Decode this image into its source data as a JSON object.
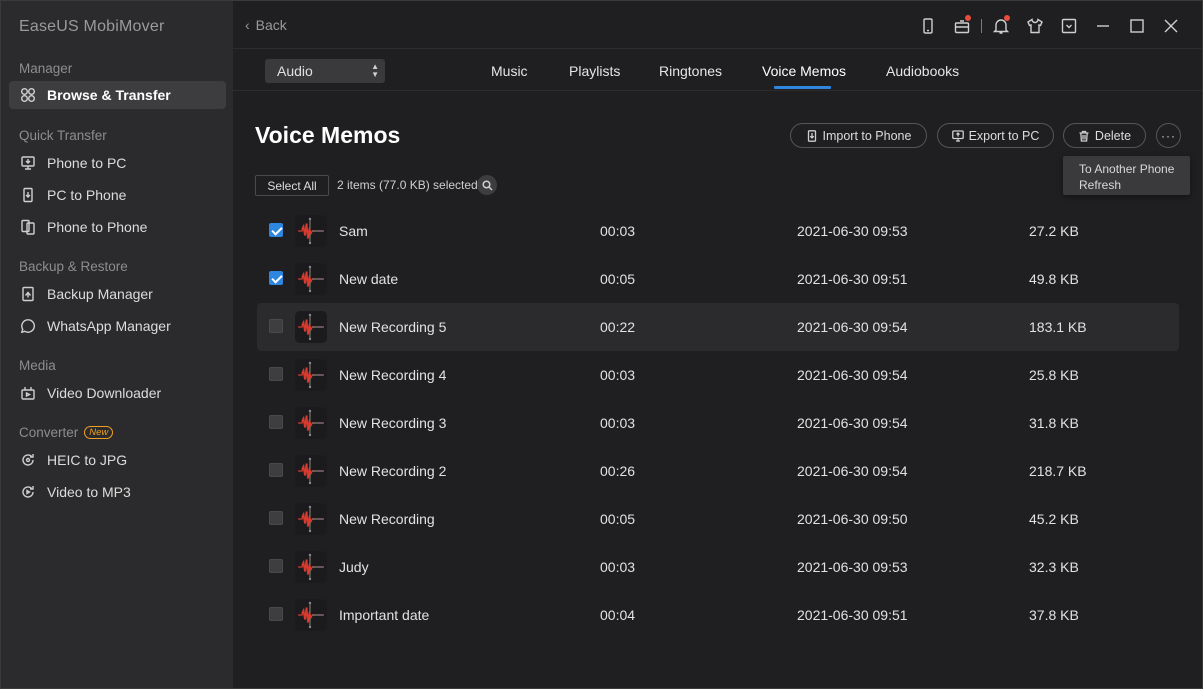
{
  "app": {
    "title": "EaseUS MobiMover"
  },
  "sidebar": {
    "sections": [
      {
        "heading": "Manager",
        "items": [
          {
            "label": "Browse & Transfer",
            "icon": "grid-icon"
          }
        ]
      },
      {
        "heading": "Quick Transfer",
        "items": [
          {
            "label": "Phone to PC",
            "icon": "phone-to-pc-icon"
          },
          {
            "label": "PC to Phone",
            "icon": "pc-to-phone-icon"
          },
          {
            "label": "Phone to Phone",
            "icon": "phone-to-phone-icon"
          }
        ]
      },
      {
        "heading": "Backup & Restore",
        "items": [
          {
            "label": "Backup Manager",
            "icon": "backup-icon"
          },
          {
            "label": "WhatsApp Manager",
            "icon": "whatsapp-icon"
          }
        ]
      },
      {
        "heading": "Media",
        "items": [
          {
            "label": "Video Downloader",
            "icon": "video-download-icon"
          }
        ]
      },
      {
        "heading": "Converter",
        "badge": "New",
        "items": [
          {
            "label": "HEIC to JPG",
            "icon": "convert-icon"
          },
          {
            "label": "Video to MP3",
            "icon": "convert-icon"
          }
        ]
      }
    ]
  },
  "topbar": {
    "back_label": "Back",
    "icons": [
      "device-icon",
      "gift-icon",
      "bell-icon",
      "shirt-icon",
      "dropdown-menu-icon",
      "minimize-icon",
      "maximize-icon",
      "close-icon"
    ]
  },
  "tabbar": {
    "category": "Audio",
    "tabs": [
      "Music",
      "Playlists",
      "Ringtones",
      "Voice Memos",
      "Audiobooks"
    ],
    "active_tab": "Voice Memos"
  },
  "main": {
    "title": "Voice Memos",
    "actions": {
      "import": "Import to Phone",
      "export": "Export to PC",
      "delete": "Delete",
      "more": "···"
    },
    "more_menu": [
      "To Another Phone",
      "Refresh"
    ],
    "select_all": "Select All",
    "selection_info": "2 items (77.0 KB) selected"
  },
  "colors": {
    "accent": "#2e86de",
    "memo_icon": "#d63a2f"
  },
  "memos": [
    {
      "name": "Sam",
      "duration": "00:03",
      "date": "2021-06-30 09:53",
      "size": "27.2 KB",
      "checked": true
    },
    {
      "name": "New date",
      "duration": "00:05",
      "date": "2021-06-30 09:51",
      "size": "49.8 KB",
      "checked": true
    },
    {
      "name": "New Recording 5",
      "duration": "00:22",
      "date": "2021-06-30 09:54",
      "size": "183.1 KB",
      "checked": false
    },
    {
      "name": "New Recording 4",
      "duration": "00:03",
      "date": "2021-06-30 09:54",
      "size": "25.8 KB",
      "checked": false
    },
    {
      "name": "New Recording 3",
      "duration": "00:03",
      "date": "2021-06-30 09:54",
      "size": "31.8 KB",
      "checked": false
    },
    {
      "name": "New Recording 2",
      "duration": "00:26",
      "date": "2021-06-30 09:54",
      "size": "218.7 KB",
      "checked": false
    },
    {
      "name": "New Recording",
      "duration": "00:05",
      "date": "2021-06-30 09:50",
      "size": "45.2 KB",
      "checked": false
    },
    {
      "name": "Judy",
      "duration": "00:03",
      "date": "2021-06-30 09:53",
      "size": "32.3 KB",
      "checked": false
    },
    {
      "name": "Important date",
      "duration": "00:04",
      "date": "2021-06-30 09:51",
      "size": "37.8 KB",
      "checked": false
    }
  ]
}
